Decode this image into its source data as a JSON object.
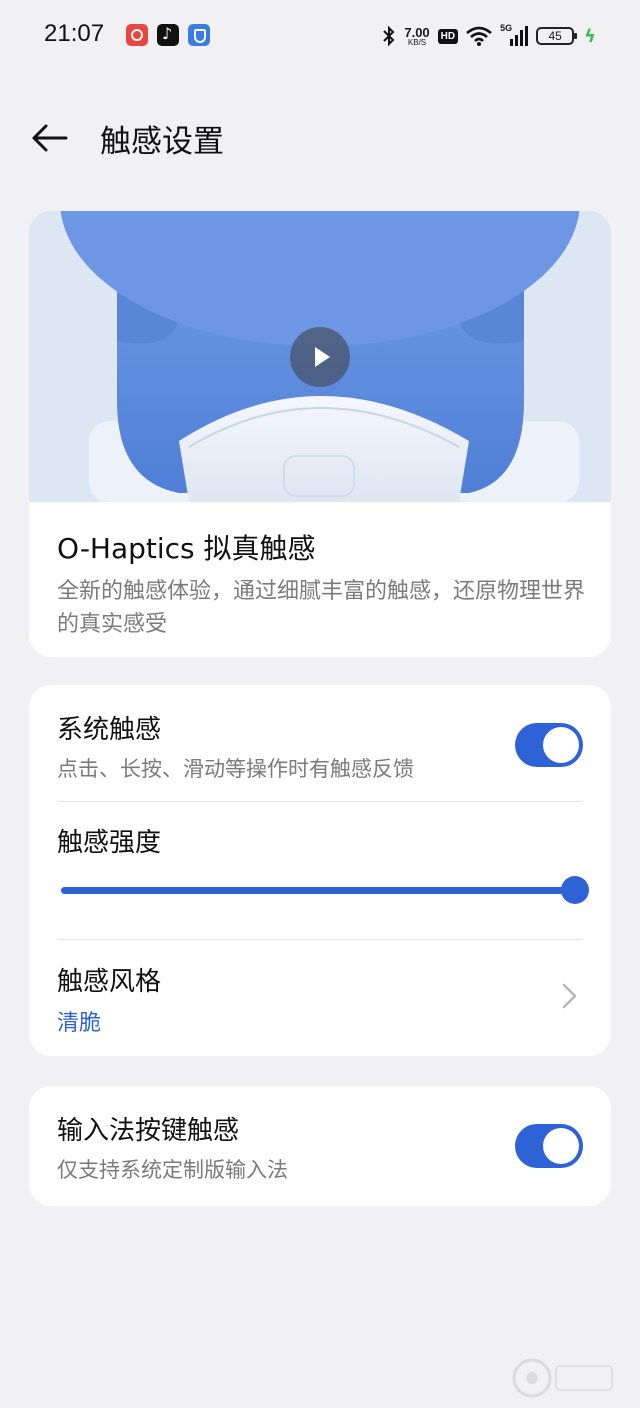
{
  "status_bar": {
    "time": "21:07",
    "net_speed_value": "7.00",
    "net_speed_unit": "KB/S",
    "hd": "HD",
    "network": "5G",
    "battery": "45"
  },
  "header": {
    "title": "触感设置"
  },
  "hero": {
    "title": "O-Haptics 拟真触感",
    "description": "全新的触感体验，通过细腻丰富的触感，还原物理世界的真实感受"
  },
  "settings": {
    "system_haptics": {
      "title": "系统触感",
      "subtitle": "点击、长按、滑动等操作时有触感反馈",
      "enabled": true
    },
    "intensity": {
      "title": "触感强度",
      "level": 1.0
    },
    "style": {
      "title": "触感风格",
      "value": "清脆"
    }
  },
  "ime": {
    "title": "输入法按键触感",
    "subtitle": "仅支持系统定制版输入法",
    "enabled": true
  },
  "colors": {
    "accent": "#2d63d6",
    "background": "#f1f1f3",
    "card": "#ffffff"
  }
}
